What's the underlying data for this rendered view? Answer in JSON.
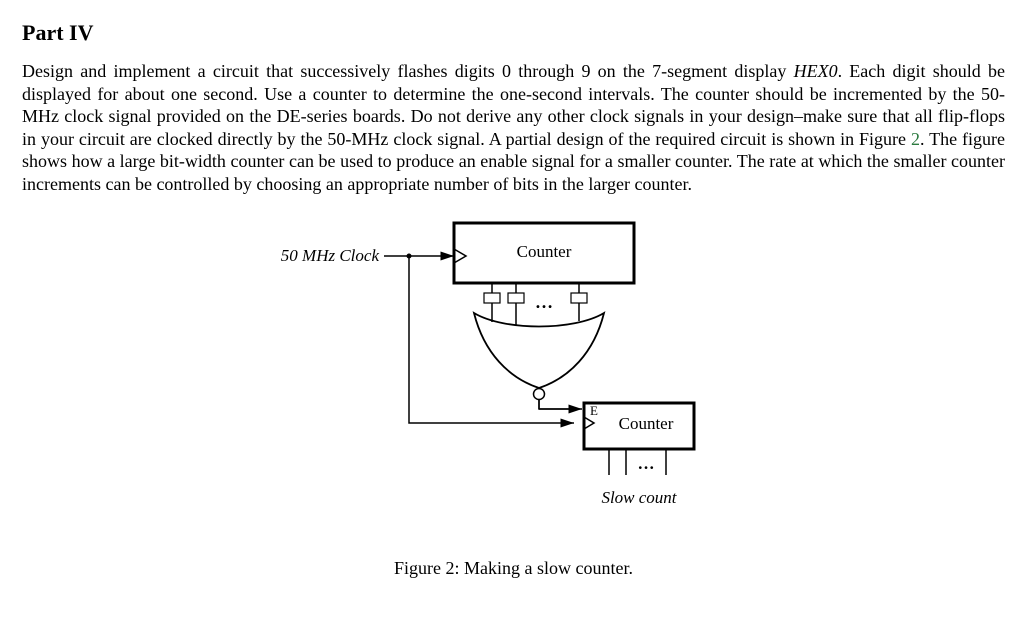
{
  "heading": "Part IV",
  "paragraph_parts": {
    "p1": "Design and implement a circuit that successively flashes digits 0 through 9 on the 7-segment display ",
    "hex0": "HEX0",
    "p2": ". Each digit should be displayed for about one second. Use a counter to determine the one-second intervals. The counter should be incremented by the 50-MHz clock signal provided on the DE-series boards. Do not derive any other clock signals in your design–make sure that all flip-flops in your circuit are clocked directly by the 50-MHz clock signal. A partial design of the required circuit is shown in Figure ",
    "figref": "2",
    "p3": ". The figure shows how a large bit-width counter can be used to produce an enable signal for a smaller counter. The rate at which the smaller counter increments can be controlled by choosing an appropriate number of bits in the larger counter."
  },
  "figure": {
    "clock_label": "50 MHz Clock",
    "counter1_label": "Counter",
    "counter2_label": "Counter",
    "enable_label": "E",
    "dots1": "…",
    "dots2": "…",
    "slow_count_label": "Slow count",
    "caption": "Figure 2: Making a slow counter."
  }
}
